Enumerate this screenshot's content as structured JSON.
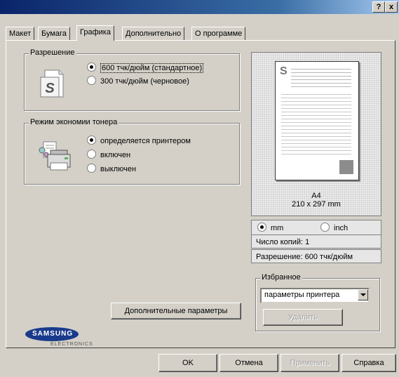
{
  "titlebar": {
    "help_label": "?",
    "close_label": "x"
  },
  "tabs": [
    "Макет",
    "Бумага",
    "Графика",
    "Дополнительно",
    "О программе"
  ],
  "resolution": {
    "legend": "Разрешение",
    "options": [
      "600 тчк/дюйм (стандартное)",
      "300 тчк/дюйм (черновое)"
    ],
    "selected": 0
  },
  "toner": {
    "legend": "Режим экономии тонера",
    "options": [
      "определяется принтером",
      "включен",
      "выключен"
    ],
    "selected": 0
  },
  "advanced_button": "Дополнительные параметры",
  "preview": {
    "page_letter": "S",
    "paper_name": "A4",
    "paper_size": "210 x 297 mm",
    "units": [
      "mm",
      "inch"
    ],
    "unit_selected": 0,
    "copies": "Число копий: 1",
    "resolution": "Разрешение: 600 тчк/дюйм"
  },
  "favorites": {
    "legend": "Избранное",
    "value": "параметры принтера",
    "delete_label": "Удалить"
  },
  "logo": {
    "brand": "SAMSUNG",
    "sub": "ELECTRONICS"
  },
  "footer": {
    "ok": "OK",
    "cancel": "Отмена",
    "apply": "Применить",
    "help": "Справка"
  },
  "colors": {
    "title_start": "#0a246a",
    "title_end": "#a6caf0",
    "face": "#d4d0c8",
    "logo": "#1a3b8c"
  }
}
